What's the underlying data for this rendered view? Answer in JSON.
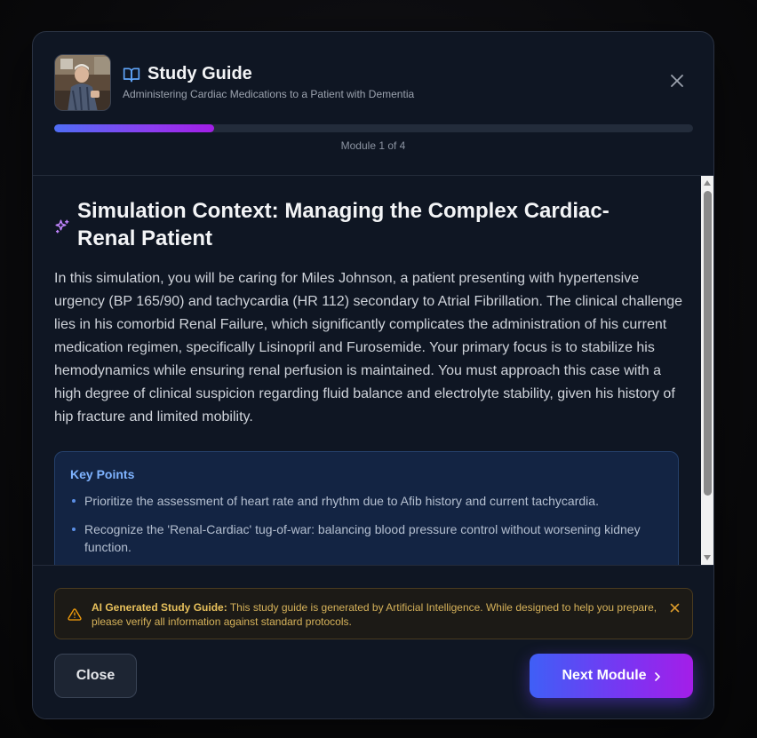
{
  "header": {
    "title": "Study Guide",
    "subtitle": "Administering Cardiac Medications to a Patient with Dementia",
    "progress_fraction": 0.25,
    "module_label": "Module 1 of 4"
  },
  "content": {
    "section_title": "Simulation Context: Managing the Complex Cardiac-Renal Patient",
    "body": "In this simulation, you will be caring for Miles Johnson, a patient presenting with hypertensive urgency (BP 165/90) and tachycardia (HR 112) secondary to Atrial Fibrillation. The clinical challenge lies in his comorbid Renal Failure, which significantly complicates the administration of his current medication regimen, specifically Lisinopril and Furosemide. Your primary focus is to stabilize his hemodynamics while ensuring renal perfusion is maintained. You must approach this case with a high degree of clinical suspicion regarding fluid balance and electrolyte stability, given his history of hip fracture and limited mobility.",
    "key_points": {
      "title": "Key Points",
      "items": [
        "Prioritize the assessment of heart rate and rhythm due to Afib history and current tachycardia.",
        "Recognize the 'Renal-Cardiac' tug-of-war: balancing blood pressure control without worsening kidney function."
      ]
    }
  },
  "footer": {
    "warning_label": "AI Generated Study Guide:",
    "warning_text": " This study guide is generated by Artificial Intelligence. While designed to help you prepare, please verify all information against standard protocols.",
    "close_label": "Close",
    "next_label": "Next Module"
  },
  "icons": {
    "title": "book-open-icon",
    "section": "sparkles-icon",
    "warning": "alert-triangle-icon",
    "close": "close-icon",
    "next": "chevron-right-icon"
  },
  "colors": {
    "accent_start": "#3f5ff6",
    "accent_end": "#a41ee8",
    "key_points_title": "#7fb3ff",
    "warning": "#d6b25a"
  }
}
